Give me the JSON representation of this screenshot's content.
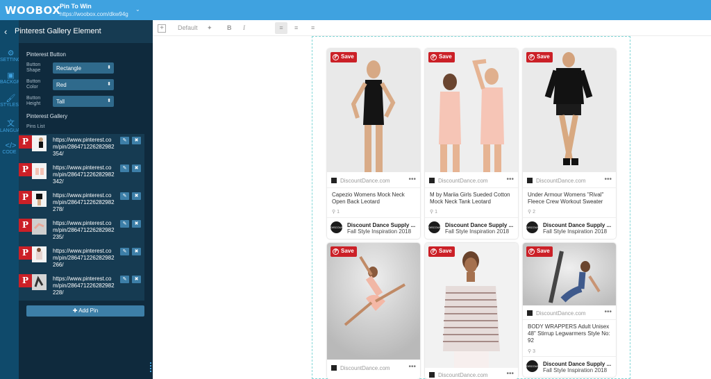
{
  "topbar": {
    "logo": "WOOBOX",
    "app_title": "Pin To Win",
    "app_url": "https://woobox.com/dkw94g",
    "url_chevron": "⌄"
  },
  "rail": [
    {
      "icon": "gear-icon",
      "glyph": "⚙",
      "label": "SETTINGS"
    },
    {
      "icon": "image-icon",
      "glyph": "▣",
      "label": "BACKGROUND"
    },
    {
      "icon": "brush-icon",
      "glyph": "🖌",
      "label": "STYLES"
    },
    {
      "icon": "language-icon",
      "glyph": "文",
      "label": "LANGUAGE"
    },
    {
      "icon": "code-icon",
      "glyph": "</>",
      "label": "CODE"
    }
  ],
  "sidebar": {
    "back": "‹",
    "title": "Pinterest Gallery Element",
    "button_section": "Pinterest Button",
    "shape_label1": "Button",
    "shape_label2": "Shape",
    "shape_value": "Rectangle",
    "color_label1": "Button",
    "color_label2": "Color",
    "color_value": "Red",
    "height_label1": "Button",
    "height_label2": "Height",
    "height_value": "Tall",
    "gallery_section": "Pinterest Gallery",
    "pins_label": "Pins List",
    "pins": [
      {
        "url": "https://www.pinterest.com/pin/286471226282982354/"
      },
      {
        "url": "https://www.pinterest.com/pin/286471226282982342/"
      },
      {
        "url": "https://www.pinterest.com/pin/286471226282982278/"
      },
      {
        "url": "https://www.pinterest.com/pin/286471226282982235/"
      },
      {
        "url": "https://www.pinterest.com/pin/286471226282982266/"
      },
      {
        "url": "https://www.pinterest.com/pin/286471226282982228/"
      }
    ],
    "p_glyph": "P",
    "edit_glyph": "✎",
    "delete_glyph": "✖",
    "add_pin": "✚ Add Pin"
  },
  "toolbar": {
    "add": "+",
    "style": "Default",
    "magic": "✦",
    "bold": "B",
    "italic": "I",
    "align_left": "≡",
    "align_center": "≡",
    "align_right": "≡"
  },
  "cards": [
    {
      "save": "Save",
      "source": "DiscountDance.com",
      "dots": "•••",
      "title": "Capezio Womens Mock Neck Open Back Leotard",
      "saves": "⚲ 1",
      "user": "Discount Dance Supply ...",
      "board": "Fall Style Inspiration 2018",
      "bg": "#e9e9e9"
    },
    {
      "save": "Save",
      "source": "DiscountDance.com",
      "dots": "•••",
      "title": "M by Mariia Girls Sueded Cotton Mock Neck Tank Leotard",
      "saves": "⚲ 1",
      "user": "Discount Dance Supply ...",
      "board": "Fall Style Inspiration 2018",
      "bg": "#eeeeee"
    },
    {
      "save": "Save",
      "source": "DiscountDance.com",
      "dots": "•••",
      "title": "Under Armour Womens ''Rival'' Fleece Crew Workout Sweater",
      "saves": "⚲ 2",
      "user": "Discount Dance Supply ...",
      "board": "Fall Style Inspiration 2018",
      "bg": "#eaeaea"
    },
    {
      "save": "Save",
      "source": "DiscountDance.com",
      "dots": "•••",
      "bg": "#d6d6d6"
    },
    {
      "save": "Save",
      "source": "DiscountDance.com",
      "dots": "•••",
      "bg": "#f2f2f2"
    },
    {
      "save": "Save",
      "source": "DiscountDance.com",
      "dots": "•••",
      "title": "BODY WRAPPERS Adult Unisex 48'' Stirrup Legwarmers Style No: 92",
      "saves": "⚲ 3",
      "user": "Discount Dance Supply ...",
      "board": "Fall Style Inspiration 2018",
      "bg": "#dcdcdc"
    }
  ],
  "avatar_text": "DISCOUNT DANCE"
}
